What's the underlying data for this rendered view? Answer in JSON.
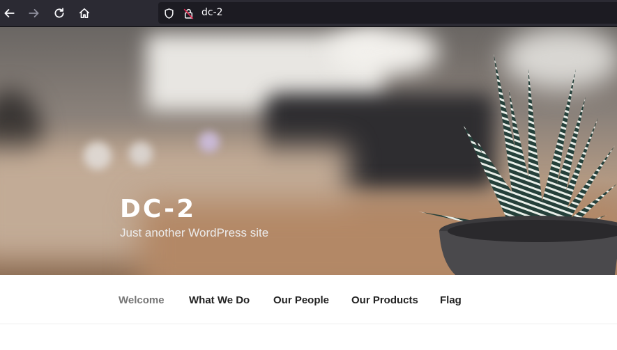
{
  "browser": {
    "back_icon": "arrow-left-icon",
    "forward_icon": "arrow-right-icon",
    "reload_icon": "reload-icon",
    "home_icon": "home-icon",
    "shield_icon": "shield-icon",
    "insecure_lock_icon": "insecure-lock-icon",
    "url": "dc-2",
    "colors": {
      "toolbar": "#2b2a33",
      "urlbar": "#1c1b22",
      "insecure": "#e22850"
    }
  },
  "site": {
    "title": "DC-2",
    "description": "Just another WordPress site"
  },
  "menu": {
    "items": [
      {
        "label": "Welcome",
        "current": true
      },
      {
        "label": "What We Do",
        "current": false
      },
      {
        "label": "Our People",
        "current": false
      },
      {
        "label": "Our Products",
        "current": false
      },
      {
        "label": "Flag",
        "current": false
      }
    ]
  }
}
